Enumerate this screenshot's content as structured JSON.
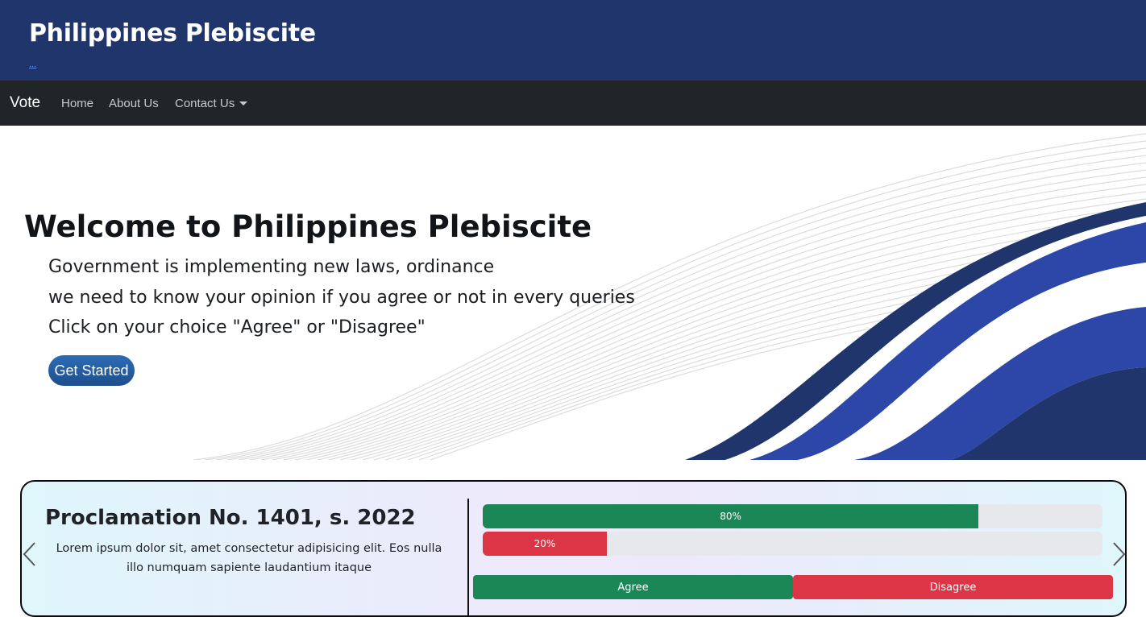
{
  "header": {
    "title": "Philippines Plebiscite",
    "link_text": "..."
  },
  "navbar": {
    "brand": "Vote",
    "items": [
      {
        "label": "Home"
      },
      {
        "label": "About Us"
      },
      {
        "label": "Contact Us",
        "has_dropdown": true
      }
    ]
  },
  "hero": {
    "title": "Welcome to Philippines Plebiscite",
    "lines": [
      "Government is implementing new laws, ordinance",
      "we need to know your opinion if you agree or not in every queries",
      "Click on your choice \"Agree\" or \"Disagree\""
    ],
    "cta_label": "Get Started"
  },
  "poll": {
    "title": "Proclamation No. 1401, s. 2022",
    "description": "Lorem ipsum dolor sit, amet consectetur adipisicing elit. Eos nulla illo numquam sapiente laudantium itaque",
    "results": {
      "agree_percent": 80,
      "agree_label": "80%",
      "disagree_percent": 20,
      "disagree_label": "20%"
    },
    "agree_button": "Agree",
    "disagree_button": "Disagree"
  },
  "colors": {
    "header_bg": "#20356b",
    "navbar_bg": "#212529",
    "agree": "#1b8756",
    "disagree": "#dc3545",
    "cta": "#1f4e8c"
  },
  "icons": {
    "dropdown": "caret-down-icon",
    "prev": "chevron-left-icon",
    "next": "chevron-right-icon"
  }
}
